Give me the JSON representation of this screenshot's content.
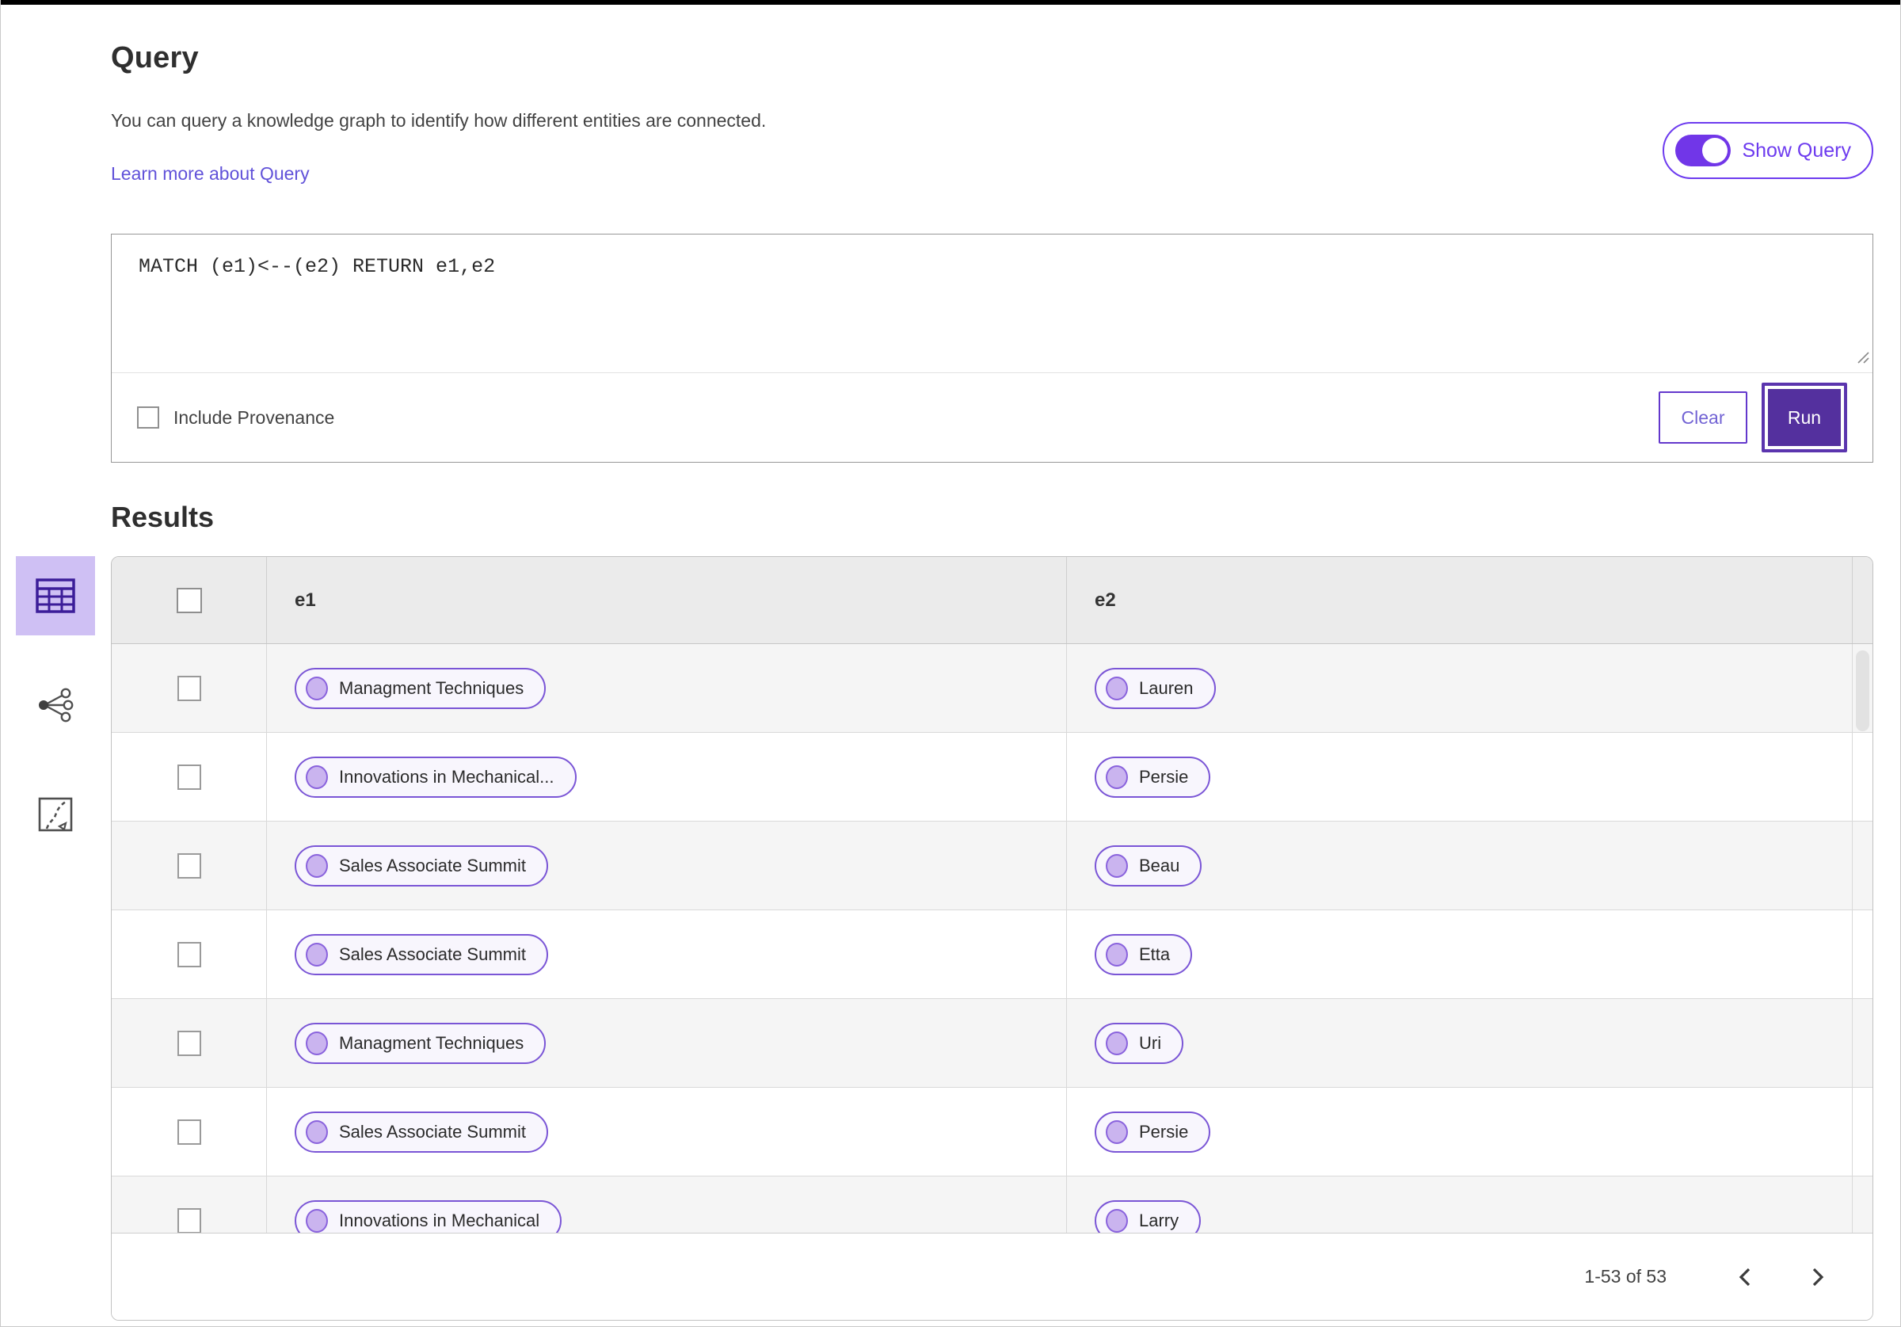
{
  "page": {
    "title": "Query",
    "description": "You can query a knowledge graph to identify how different entities are connected.",
    "learn_more_link": "Learn more about Query",
    "show_query_label": "Show Query",
    "show_query_state": "on"
  },
  "query_editor": {
    "text": "MATCH (e1)<--(e2) RETURN e1,e2",
    "include_provenance_label": "Include Provenance",
    "include_provenance_checked": false,
    "clear_label": "Clear",
    "run_label": "Run"
  },
  "results": {
    "heading": "Results",
    "view_icons": [
      "table-view",
      "network-view",
      "map-view"
    ],
    "selected_view": "table-view",
    "columns": [
      "e1",
      "e2"
    ],
    "rows": [
      {
        "e1": "Managment Techniques",
        "e2": "Lauren"
      },
      {
        "e1": "Innovations in Mechanical...",
        "e2": "Persie"
      },
      {
        "e1": "Sales Associate Summit",
        "e2": "Beau"
      },
      {
        "e1": "Sales Associate Summit",
        "e2": "Etta"
      },
      {
        "e1": "Managment Techniques",
        "e2": "Uri"
      },
      {
        "e1": "Sales Associate Summit",
        "e2": "Persie"
      },
      {
        "e1": "Innovations in Mechanical",
        "e2": "Larry"
      }
    ],
    "pagination": {
      "range_text": "1-53 of 53"
    }
  },
  "colors": {
    "accent_bright": "#6d3bef",
    "accent_dark": "#54309e",
    "pill_border": "#7a55d6",
    "pill_bg": "#f8f6fd",
    "link": "#6152d9",
    "selected_tile_bg": "#cfc0f4",
    "header_row_bg": "#ebebeb",
    "odd_row_bg": "#f5f5f5"
  }
}
